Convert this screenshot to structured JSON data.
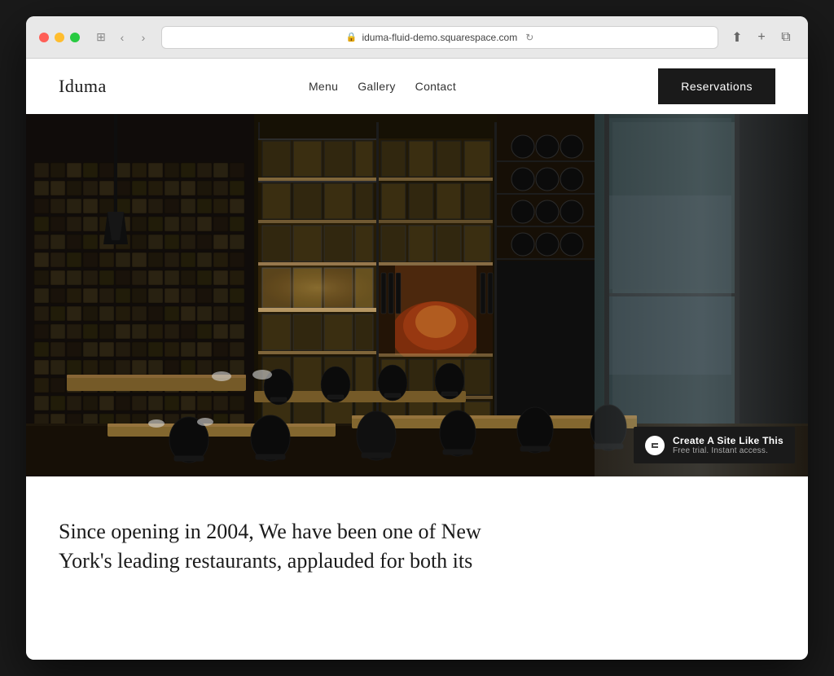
{
  "browser": {
    "url": "iduma-fluid-demo.squarespace.com",
    "controls": {
      "back": "‹",
      "forward": "›"
    },
    "window_icon": "⊞"
  },
  "site": {
    "logo": "Iduma",
    "nav": {
      "items": [
        {
          "label": "Menu",
          "href": "#"
        },
        {
          "label": "Gallery",
          "href": "#"
        },
        {
          "label": "Contact",
          "href": "#"
        }
      ],
      "cta_label": "Reservations"
    },
    "hero_alt": "Restaurant interior with wood tables and wine shelving",
    "body_text": "Since opening in 2004, We have been one of New York's leading restaurants, applauded for both its"
  },
  "squarespace_badge": {
    "title": "Create A Site Like This",
    "subtitle": "Free trial. Instant access."
  },
  "colors": {
    "header_bg": "#ffffff",
    "cta_bg": "#1a1a1a",
    "cta_text": "#ffffff",
    "logo_color": "#1a1a1a",
    "nav_text": "#333333",
    "body_text_color": "#1a1a1a"
  }
}
